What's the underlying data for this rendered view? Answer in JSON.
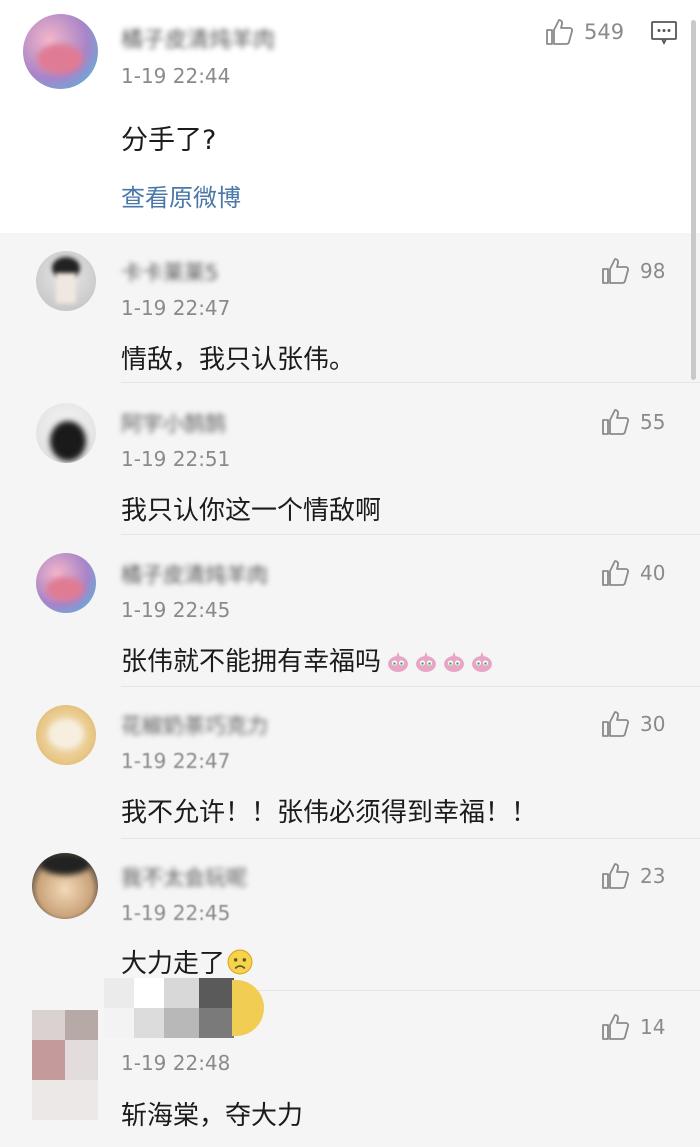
{
  "post": {
    "username": "橘子皮清炖羊肉",
    "time": "1-19 22:44",
    "text": "分手了?",
    "like_count": "549",
    "view_original": "查看原微博"
  },
  "replies": [
    {
      "username": "卡卡莱莱5",
      "time": "1-19 22:47",
      "text": "情敌，我只认张伟。",
      "likes": "98"
    },
    {
      "username": "阿宇小鹄鹄",
      "time": "1-19 22:51",
      "text": "我只认你这一个情敌啊",
      "likes": "55"
    },
    {
      "username": "橘子皮清炖羊肉",
      "time": "1-19 22:45",
      "text": "张伟就不能拥有幸福吗",
      "likes": "40"
    },
    {
      "username": "花椒奶茶巧克力",
      "time": "1-19 22:47",
      "text": "我不允许！！张伟必须得到幸福！！",
      "likes": "30"
    },
    {
      "username": "我不太会玩呢",
      "time": "1-19 22:45",
      "text": "大力走了",
      "likes": "23"
    },
    {
      "username": "",
      "time": "1-19 22:48",
      "text": "斩海棠，夺大力",
      "likes": "14"
    }
  ],
  "icons": {
    "like": "thumbs-up-icon",
    "comment": "comment-icon",
    "emoji_cry": "crying-chick-emoji",
    "emoji_sad": "sad-face-emoji"
  },
  "colors": {
    "reply_background": "#f5f5f5",
    "link": "#4a77a8",
    "meta": "#8a8a8a"
  }
}
